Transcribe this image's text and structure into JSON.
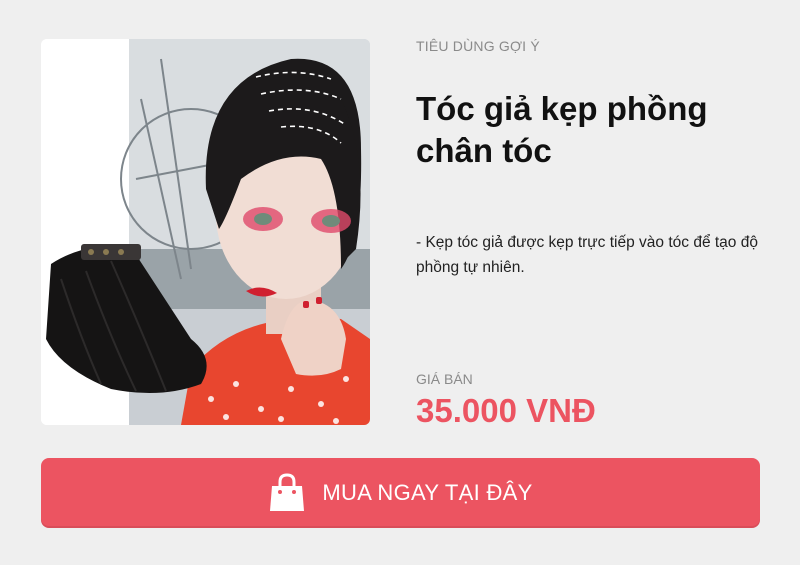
{
  "card": {
    "category": "TIÊU DÙNG GỢI Ý",
    "title": "Tóc giả kẹp phồng chân tóc",
    "description": "- Kẹp tóc giả được kẹp trực tiếp vào tóc để tạo độ phồng tự nhiên.",
    "price_label": "GIÁ BÁN",
    "price_value": "35.000 VNĐ"
  },
  "buy_button": {
    "label": "MUA NGAY TẠI ĐÂY",
    "icon": "shopping-bag-icon"
  },
  "colors": {
    "background": "#efefef",
    "accent": "#ec5461",
    "title": "#111111",
    "muted": "#8a8a8a"
  }
}
